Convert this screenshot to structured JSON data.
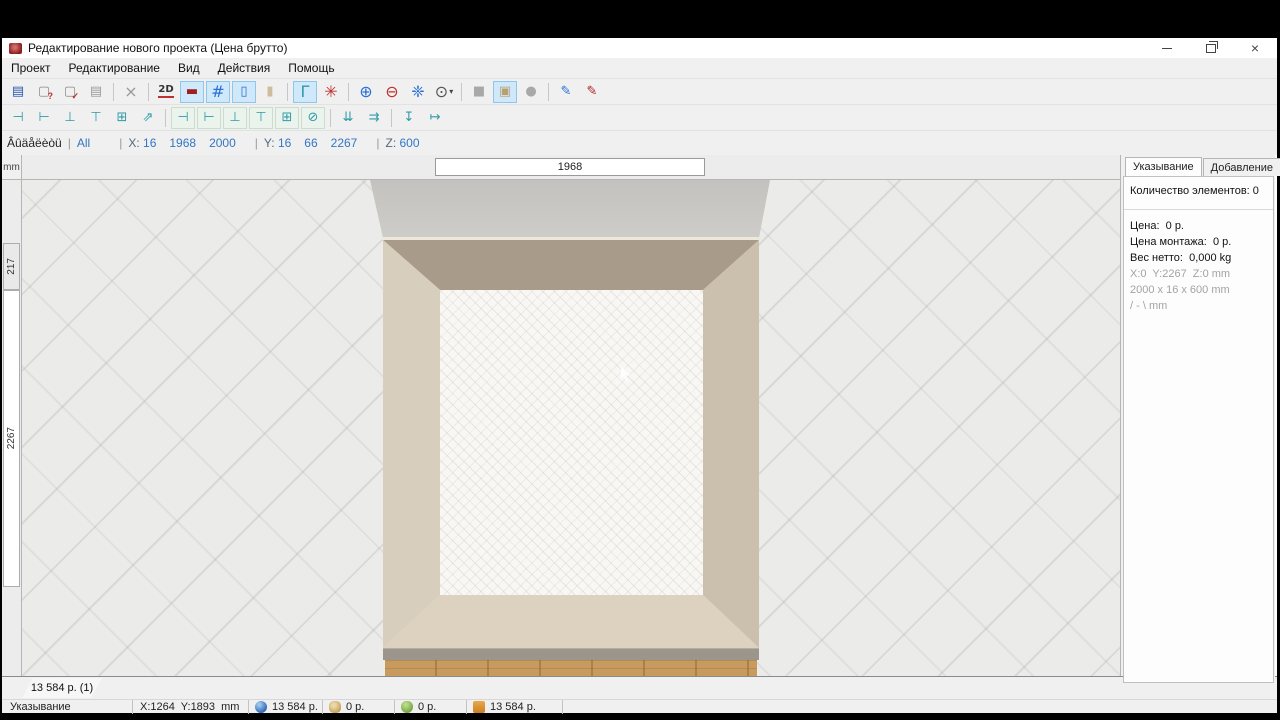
{
  "title_bar": {
    "title": "Редактирование нового проекта (Цена брутто)"
  },
  "window_controls": {
    "icons": [
      "minimize-icon",
      "restore-icon",
      "close-icon"
    ]
  },
  "menu": {
    "items": [
      "Проект",
      "Редактирование",
      "Вид",
      "Действия",
      "Помощь"
    ]
  },
  "toolbar_main": {
    "items": [
      {
        "name": "save-icon",
        "glyph": "▤",
        "color": "#2a56b0"
      },
      {
        "name": "new-question-icon",
        "glyph": "▢",
        "color": "#8a8a8a",
        "overlay": "?",
        "overlay_color": "#c03030"
      },
      {
        "name": "new-check-icon",
        "glyph": "▢",
        "color": "#8a8a8a",
        "overlay": "✓",
        "overlay_color": "#c03030"
      },
      {
        "name": "print-icon",
        "glyph": "▤",
        "color": "#9a9a9a"
      },
      {
        "sep": true
      },
      {
        "name": "delete-icon",
        "glyph": "×",
        "color": "#9a9a9a",
        "big": true
      },
      {
        "sep": true
      },
      {
        "name": "dimensions-2d-icon",
        "glyph": "2D",
        "color": "#333333",
        "underline": true,
        "text": true
      },
      {
        "name": "section-view-icon",
        "glyph": "▬",
        "color": "#a02020",
        "active": true
      },
      {
        "name": "grid-icon",
        "glyph": "#",
        "color": "#2a6fd4",
        "active": true,
        "big": true
      },
      {
        "name": "contour-icon",
        "glyph": "▯",
        "color": "#2a6fd4",
        "active": true
      },
      {
        "name": "texture-panel-icon",
        "glyph": "▮",
        "color": "#cdbd9c"
      },
      {
        "sep": true
      },
      {
        "name": "corner-axes-icon",
        "glyph": "Γ",
        "color": "#2e9aa8",
        "active": true,
        "big": true
      },
      {
        "name": "snap-star-icon",
        "glyph": "✳",
        "color": "#c03030",
        "big": true
      },
      {
        "sep": true
      },
      {
        "name": "zoom-in-icon",
        "glyph": "⊕",
        "color": "#2a6fd4",
        "big": true
      },
      {
        "name": "zoom-out-icon",
        "glyph": "⊖",
        "color": "#c03030",
        "big": true
      },
      {
        "name": "zoom-fit-icon",
        "glyph": "❈",
        "color": "#2a6fd4",
        "big": true
      },
      {
        "name": "zoom-select-icon",
        "glyph": "⊙",
        "color": "#555555",
        "big": true,
        "caret": true
      },
      {
        "sep": true
      },
      {
        "name": "render-solid-icon",
        "glyph": "■",
        "color": "#a8a8a8"
      },
      {
        "name": "render-overlay-icon",
        "glyph": "▣",
        "color": "#b89f6e",
        "active": true
      },
      {
        "name": "render-sphere-icon",
        "glyph": "●",
        "color": "#a8a8a8"
      },
      {
        "sep": true
      },
      {
        "name": "edit-add-icon",
        "glyph": "✎",
        "color": "#2a6fd4"
      },
      {
        "name": "edit-remove-icon",
        "glyph": "✎",
        "color": "#b22222"
      }
    ]
  },
  "toolbar_panels": {
    "items": [
      {
        "name": "panel-left-icon",
        "glyph": "⊣"
      },
      {
        "name": "panel-right-icon",
        "glyph": "⊢"
      },
      {
        "name": "panel-top-icon",
        "glyph": "⊥"
      },
      {
        "name": "panel-bottom-icon",
        "glyph": "⊤"
      },
      {
        "name": "panel-back-icon",
        "glyph": "⊞"
      },
      {
        "name": "panel-free-icon",
        "glyph": "⇗"
      },
      {
        "sep": true
      },
      {
        "name": "insert-left-icon",
        "glyph": "⊣",
        "boxed": true
      },
      {
        "name": "insert-right-icon",
        "glyph": "⊢",
        "boxed": true
      },
      {
        "name": "insert-top-icon",
        "glyph": "⊥",
        "boxed": true
      },
      {
        "name": "insert-bottom-icon",
        "glyph": "⊤",
        "boxed": true
      },
      {
        "name": "insert-box-icon",
        "glyph": "⊞",
        "boxed": true
      },
      {
        "name": "insert-none-icon",
        "glyph": "⊘",
        "boxed": true
      },
      {
        "sep": true
      },
      {
        "name": "spacing-vertical-icon",
        "glyph": "⇊"
      },
      {
        "name": "spacing-horizontal-icon",
        "glyph": "⇉"
      },
      {
        "sep": true
      },
      {
        "name": "fit-height-icon",
        "glyph": "↧"
      },
      {
        "name": "fit-width-icon",
        "glyph": "↦"
      }
    ]
  },
  "filter_bar": {
    "select_label": "Âûäåëèòü",
    "select_value": "All",
    "x_label": "X:",
    "x_values": [
      "16",
      "1968",
      "2000"
    ],
    "y_label": "Y:",
    "y_values": [
      "16",
      "66",
      "2267"
    ],
    "z_label": "Z:",
    "z_values": [
      "600"
    ]
  },
  "rulers": {
    "unit": "mm",
    "horizontal_value": "1968",
    "vertical_value_upper": "217",
    "vertical_value_lower": "2267"
  },
  "right_panel": {
    "tabs": [
      {
        "label": "Указывание",
        "active": true
      },
      {
        "label": "Добавление",
        "active": false
      }
    ],
    "element_count_label": "Количество элементов:",
    "element_count_value": "0",
    "price_label": "Цена:",
    "price_value": "0 р.",
    "montage_label": "Цена монтажа:",
    "montage_value": "0 р.",
    "weight_label": "Вес нетто:",
    "weight_value": "0,000 kg",
    "position_line": "X:0  Y:2267  Z:0 mm",
    "size_line": "2000 x 16 x 600 mm",
    "angle_line": "/ - \\ mm"
  },
  "sheet_tab": {
    "label": "13 584 р. (1)"
  },
  "status_bar": {
    "mode": "Указывание",
    "cursor_position": "X:1264  Y:1893  mm",
    "totals": [
      {
        "icon": "globe-icon",
        "value": "13 584 р."
      },
      {
        "icon": "coins-icon",
        "value": "0 р."
      },
      {
        "icon": "jug-icon",
        "value": "0 р."
      },
      {
        "icon": "parts-icon",
        "value": "13 584 р."
      }
    ]
  },
  "colors": {
    "accent_blue": "#3276c3",
    "toolbar_active_bg": "#cfe8fa",
    "teal_icon": "#2e9aa8",
    "wood_floor": "#c79a5e",
    "panel_taupe": "#a89b8a",
    "panel_beige": "#d8cebe"
  }
}
